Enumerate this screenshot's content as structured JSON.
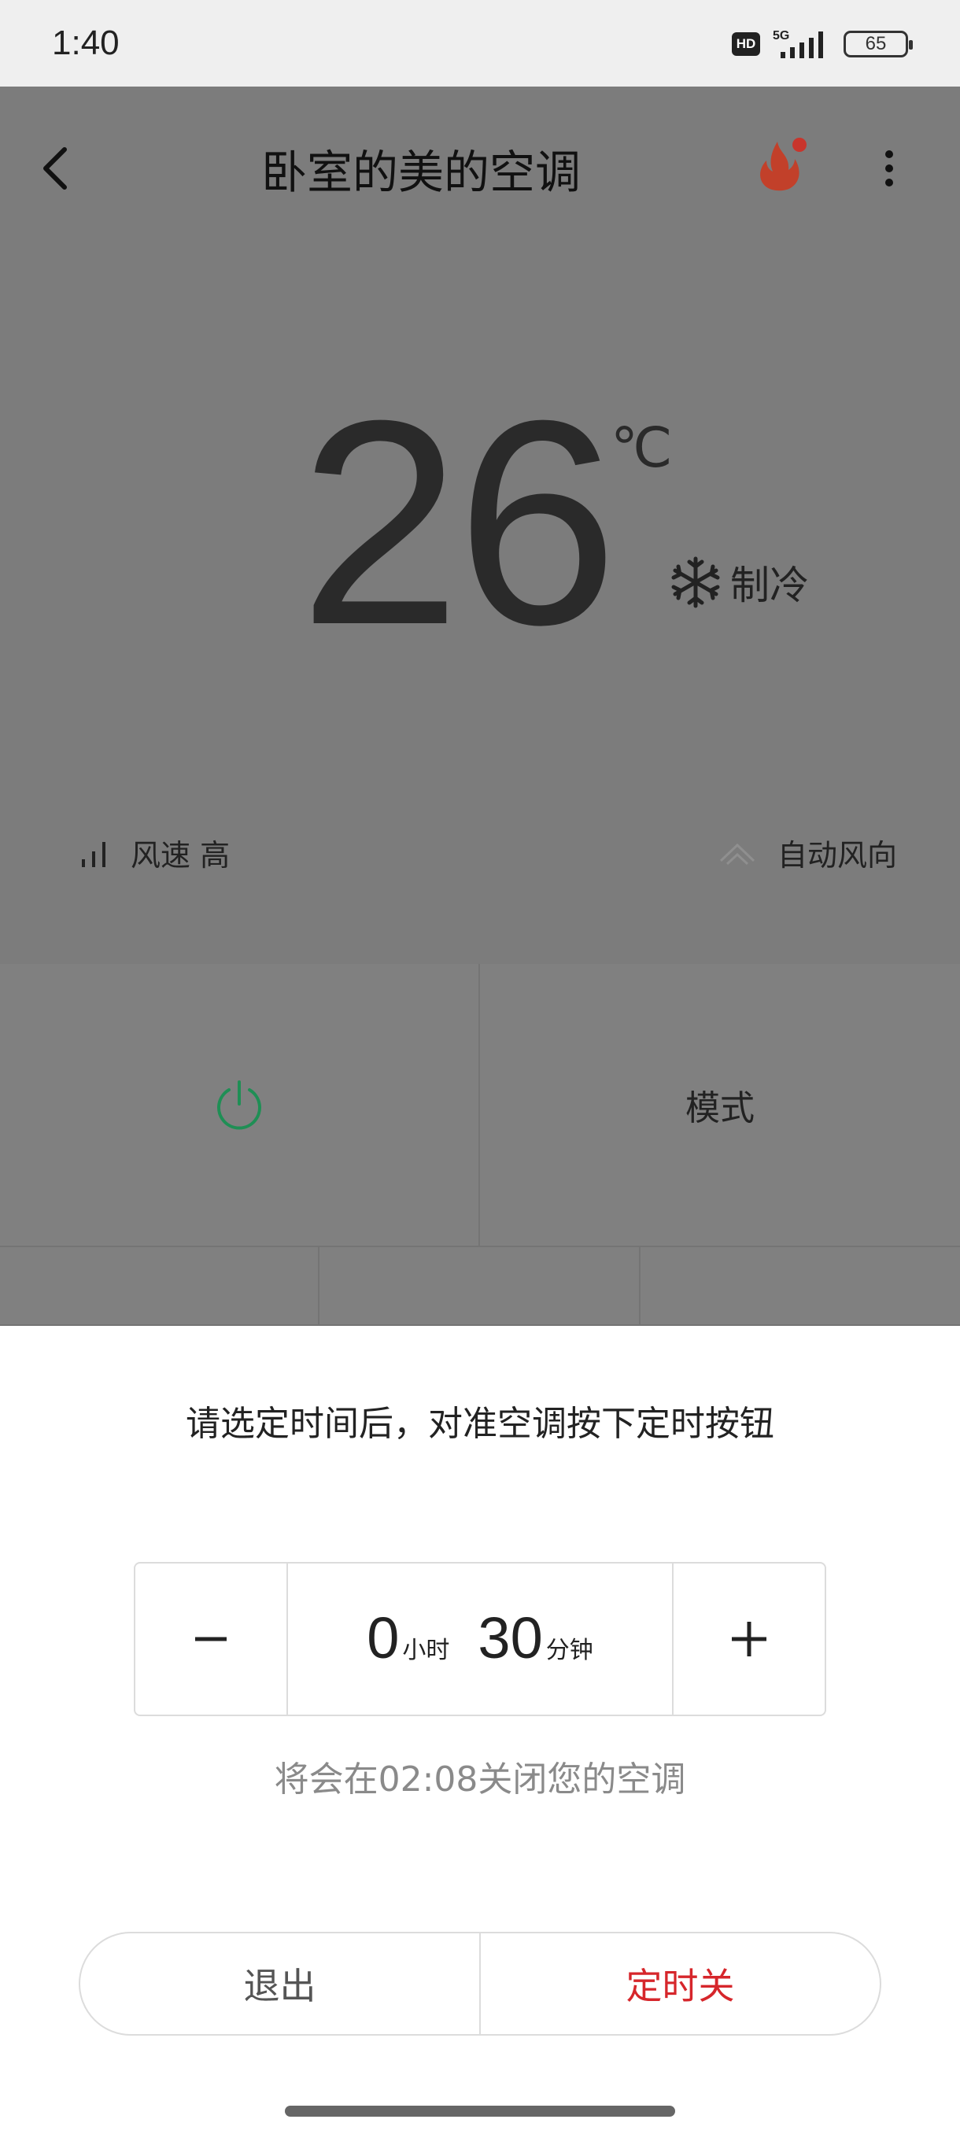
{
  "status_bar": {
    "time": "1:40",
    "hd": "HD",
    "network": "5G",
    "battery": "65"
  },
  "header": {
    "title": "卧室的美的空调",
    "icons": [
      "back-icon",
      "fire-icon",
      "more-icon"
    ]
  },
  "device": {
    "temperature": "26",
    "unit": "℃",
    "mode": "制冷",
    "mode_icon": "snowflake-icon",
    "fan_speed": "风速 高",
    "wind_direction": "自动风向"
  },
  "controls": {
    "mode_button": "模式",
    "power_color": "#1f8f55"
  },
  "timer_sheet": {
    "instruction": "请选定时间后，对准空调按下定时按钮",
    "hours": "0",
    "hours_unit": "小时",
    "minutes": "30",
    "minutes_unit": "分钟",
    "note": "将会在02:08关闭您的空调",
    "exit_label": "退出",
    "confirm_label": "定时关",
    "confirm_color": "#d6262b"
  }
}
